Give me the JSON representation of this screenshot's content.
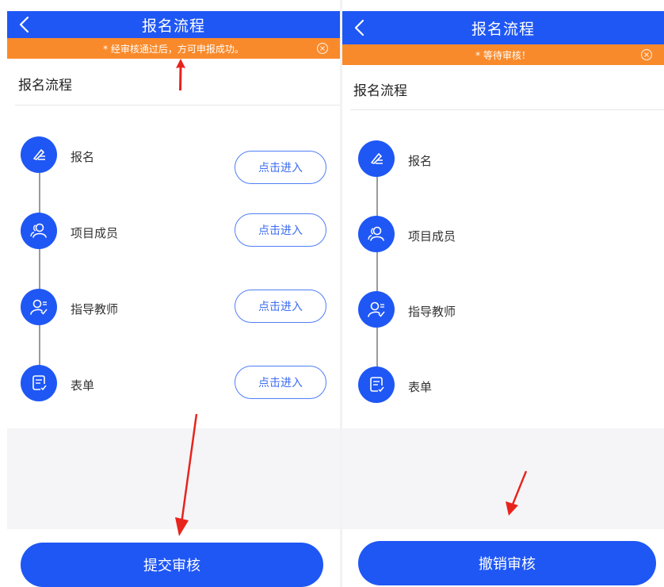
{
  "left_panel": {
    "header_title": "报名流程",
    "notice_text": "* 经审核通过后，方可申报成功。",
    "section_title": "报名流程",
    "steps": [
      {
        "label": "报名",
        "button": "点击进入",
        "icon": "pen-icon"
      },
      {
        "label": "项目成员",
        "button": "点击进入",
        "icon": "users-icon"
      },
      {
        "label": "指导教师",
        "button": "点击进入",
        "icon": "teacher-icon"
      },
      {
        "label": "表单",
        "button": "点击进入",
        "icon": "form-icon"
      }
    ],
    "primary_button": "提交审核"
  },
  "right_panel": {
    "header_title": "报名流程",
    "notice_text": "* 等待审核！",
    "section_title": "报名流程",
    "steps": [
      {
        "label": "报名",
        "icon": "pen-icon"
      },
      {
        "label": "项目成员",
        "icon": "users-icon"
      },
      {
        "label": "指导教师",
        "icon": "teacher-icon"
      },
      {
        "label": "表单",
        "icon": "form-icon"
      }
    ],
    "primary_button": "撤销审核"
  },
  "colors": {
    "header_blue": "#1f57f5",
    "notice_orange": "#f98a2b",
    "annotation_red": "#e8231c"
  }
}
